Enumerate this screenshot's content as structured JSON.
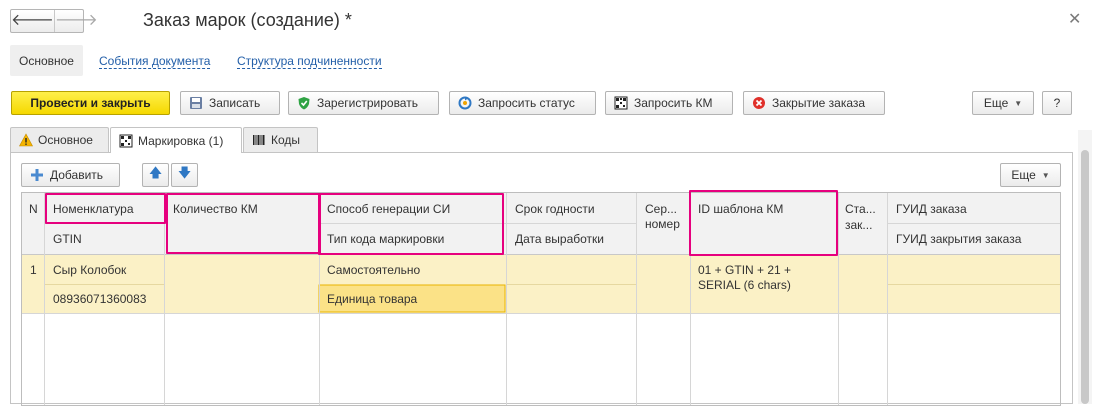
{
  "window": {
    "title": "Заказ марок (создание) *",
    "back_glyph": "🡐",
    "forward_glyph": "🡒",
    "close_glyph": "✕"
  },
  "top_links": {
    "main": "Основное",
    "events": "События документа",
    "structure": "Структура подчиненности"
  },
  "toolbar": {
    "post_close": "Провести и закрыть",
    "save": "Записать",
    "register": "Зарегистрировать",
    "request_status": "Запросить статус",
    "request_km": "Запросить КМ",
    "close_order": "Закрытие заказа",
    "more": "Еще",
    "help": "?"
  },
  "tabs": {
    "main": "Основное",
    "marking": "Маркировка (1)",
    "codes": "Коды"
  },
  "table_toolbar": {
    "add": "Добавить",
    "more": "Еще"
  },
  "table": {
    "headers": {
      "n": "N",
      "nomenclature": "Номенклатура",
      "gtin": "GTIN",
      "qty": "Количество КМ",
      "gen_method": "Способ генерации СИ",
      "code_type": "Тип кода маркировки",
      "expiry": "Срок годности",
      "prod_date": "Дата выработки",
      "serial_1": "Сер...",
      "serial_2": "номер",
      "template_id": "ID шаблона КМ",
      "status_1": "Ста...",
      "status_2": "зак...",
      "order_guid": "ГУИД заказа",
      "close_guid": "ГУИД закрытия заказа"
    },
    "rows": [
      {
        "n": "1",
        "nomenclature": "Сыр Колобок",
        "gtin": "08936071360083",
        "qty": "",
        "gen_method": "Самостоятельно",
        "code_type": "Единица товара",
        "expiry": "",
        "prod_date": "",
        "serial": "",
        "template_line1": "01 + GTIN + 21 +",
        "template_line2": "SERIAL (6 chars)",
        "status": "",
        "order_guid": "",
        "close_guid": ""
      }
    ]
  },
  "colors": {
    "highlight": "#e6007e",
    "row_bg": "#fbf1c6",
    "active_cell": "#fbe287",
    "primary_btn": "#f5d800",
    "link": "#225ea8"
  }
}
